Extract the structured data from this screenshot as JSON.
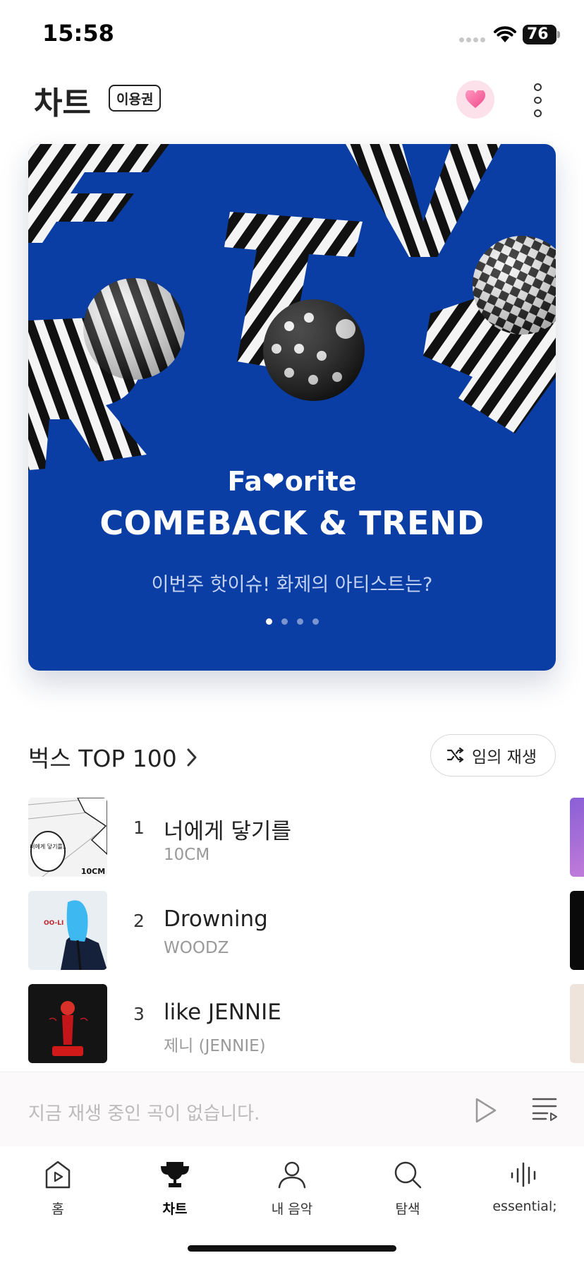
{
  "status_bar": {
    "time": "15:58",
    "battery": "76"
  },
  "header": {
    "title": "차트",
    "badge": "이용권"
  },
  "banner": {
    "brand": "Fa❤orite",
    "title": "COMEBACK & TREND",
    "subtitle": "이번주 핫이슈! 화제의 아티스트는?",
    "pages": 4,
    "active_page": 1,
    "bg_color": "#0b3ea4"
  },
  "chart_section": {
    "title": "벅스 TOP 100",
    "shuffle_label": "임의 재생"
  },
  "songs": [
    {
      "rank": "1",
      "title": "너에게 닿기를",
      "artist": "10CM",
      "art_text": "너에게 닿기를..",
      "art_tag": "10CM"
    },
    {
      "rank": "2",
      "title": "Drowning",
      "artist": "WOODZ",
      "art_text": "OO-LI"
    },
    {
      "rank": "3",
      "title": "like JENNIE",
      "artist": "제니 (JENNIE)"
    }
  ],
  "mini_player": {
    "empty_text": "지금 재생 중인 곡이 없습니다."
  },
  "tabs": [
    {
      "label": "홈",
      "icon": "home-play-icon"
    },
    {
      "label": "차트",
      "icon": "trophy-icon",
      "active": true
    },
    {
      "label": "내 음악",
      "icon": "person-icon"
    },
    {
      "label": "탐색",
      "icon": "search-icon"
    },
    {
      "label": "essential;",
      "icon": "soundwave-icon"
    }
  ]
}
